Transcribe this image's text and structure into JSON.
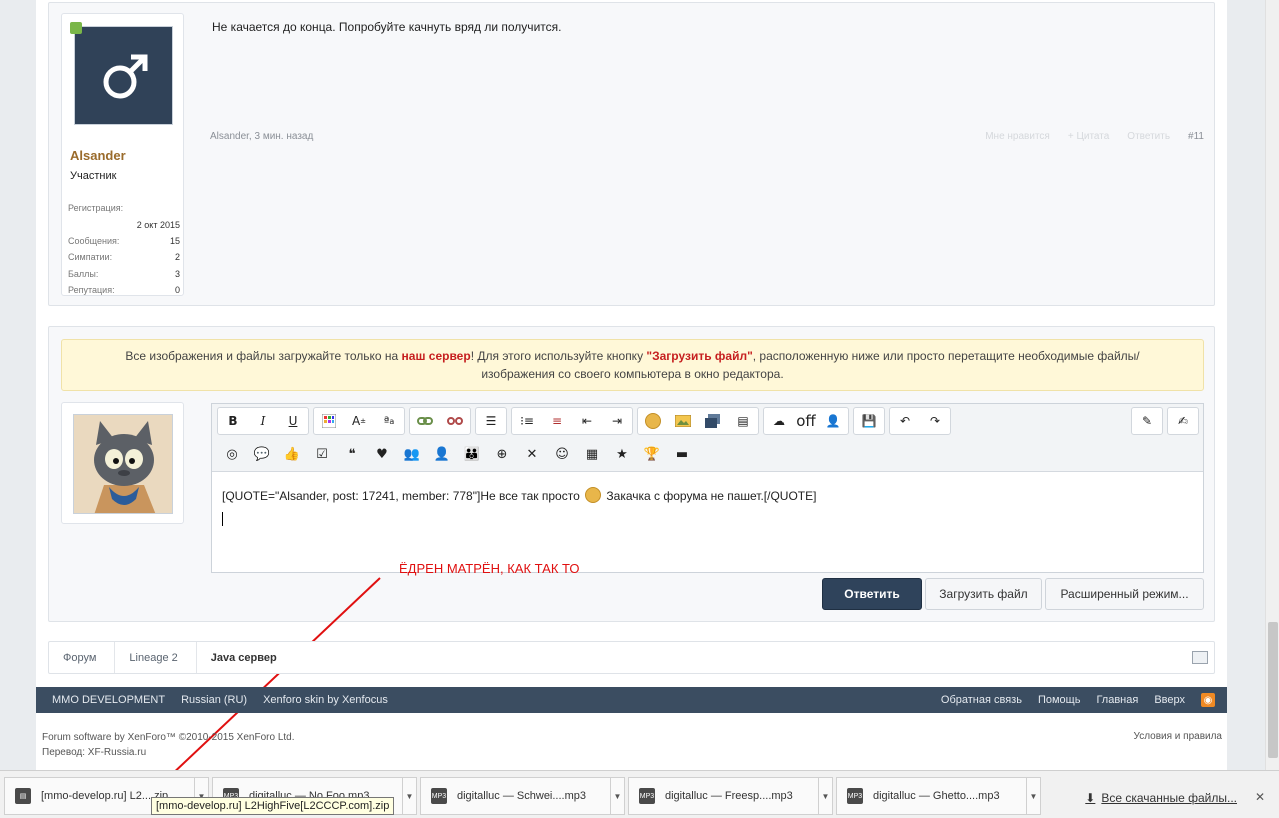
{
  "post": {
    "user": {
      "name": "Alsander",
      "title": "Участник",
      "stats": {
        "registration_label": "Регистрация:",
        "registration_value": "2 окт 2015",
        "messages_label": "Сообщения:",
        "messages_value": "15",
        "likes_label": "Симпатии:",
        "likes_value": "2",
        "points_label": "Баллы:",
        "points_value": "3",
        "reputation_label": "Репутация:",
        "reputation_value": "0"
      }
    },
    "text": "Не качается до конца. Попробуйте качнуть вряд ли получится.",
    "meta": "Alsander, 3 мин. назад",
    "actions": {
      "like": "Мне нравится",
      "quote": "+ Цитата",
      "reply": "Ответить",
      "number": "#11"
    }
  },
  "notice": {
    "part1": "Все изображения и файлы загружайте только на ",
    "server_link": "наш сервер",
    "part2": "! Для этого используйте кнопку ",
    "upload_name": "\"Загрузить файл\"",
    "part3": ", расположенную ниже или просто перетащите необходимые файлы/",
    "line2": "изображения со своего компьютера в окно редактора."
  },
  "editor": {
    "toolbar": {
      "bold": "B",
      "italic": "I",
      "underline": "U",
      "off_label": "off"
    },
    "content_part1": "[QUOTE=\"Alsander, post: 17241, member: 778\"]Не все так просто ",
    "content_part2": " Закачка с форума не пашет.[/QUOTE]"
  },
  "buttons": {
    "reply": "Ответить",
    "upload": "Загрузить файл",
    "advanced": "Расширенный режим..."
  },
  "annotation": "ЁДРЕН МАТРЁН, КАК ТАК ТО",
  "breadcrumb": [
    "Форум",
    "Lineage 2",
    "Java сервер"
  ],
  "footer": {
    "left": [
      "MMO DEVELOPMENT",
      "Russian (RU)",
      "Xenforo skin by Xenfocus"
    ],
    "right": [
      "Обратная связь",
      "Помощь",
      "Главная",
      "Вверх"
    ],
    "copyright_line1": "Forum software by XenForo™ ©2010-2015 XenForo Ltd.",
    "copyright_line2": "Перевод: XF-Russia.ru",
    "terms": "Условия и правила"
  },
  "downloads": {
    "items": [
      {
        "name": "[mmo-develop.ru] L2....zip",
        "icon": "rar-archive-icon"
      },
      {
        "name": "digitalluc — No Foo.mp3",
        "icon": "mp3-file-icon"
      },
      {
        "name": "digitalluc — Schwei....mp3",
        "icon": "mp3-file-icon"
      },
      {
        "name": "digitalluc — Freesp....mp3",
        "icon": "mp3-file-icon"
      },
      {
        "name": "digitalluc — Ghetto....mp3",
        "icon": "mp3-file-icon"
      }
    ],
    "all_label": "Все скачанные файлы...",
    "tooltip": "[mmo-develop.ru] L2HighFive[L2CCCP.com].zip"
  },
  "colors": {
    "brand_dark": "#2f435b",
    "footer_bg": "#3b4d61",
    "notice_bg": "#fff8d8",
    "notice_accent": "#c61f1f",
    "username": "#9a6b2b",
    "annotation": "#e01010"
  }
}
